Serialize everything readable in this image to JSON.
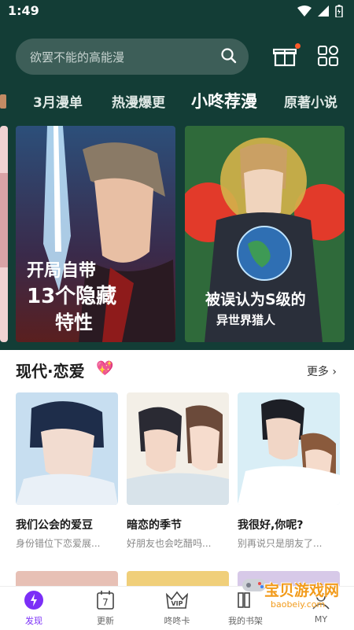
{
  "status": {
    "time": "1:49"
  },
  "search": {
    "placeholder": "欲罢不能的高能漫"
  },
  "tabs": [
    "3月漫单",
    "热漫爆更",
    "小咚荐漫",
    "原著小说"
  ],
  "active_tab_index": 2,
  "banners": [
    {
      "title_line1": "开局自带",
      "title_line2": "13个隐藏",
      "title_line3": "特性"
    },
    {
      "title_line1": "被误认为S级的",
      "title_line2": "异世界猎人"
    }
  ],
  "section": {
    "title": "现代·恋爱",
    "more": "更多"
  },
  "cards": [
    {
      "title": "我们公会的爱豆",
      "subtitle": "身份错位下恋爱展..."
    },
    {
      "title": "暗恋的季节",
      "subtitle": "好朋友也会吃醋吗..."
    },
    {
      "title": "我很好,你呢?",
      "subtitle": "别再说只是朋友了..."
    }
  ],
  "nav": [
    {
      "label": "发现",
      "icon": "discover-icon"
    },
    {
      "label": "更新",
      "icon": "calendar-icon",
      "badge": "7"
    },
    {
      "label": "咚咚卡",
      "icon": "vip-icon",
      "badge": "VIP"
    },
    {
      "label": "我的书架",
      "icon": "bookshelf-icon"
    },
    {
      "label": "MY",
      "icon": "profile-icon"
    }
  ],
  "watermark": {
    "line1": "宝贝游戏网",
    "line2": "baobeiy.com"
  },
  "colors": {
    "header_bg": "#133d36",
    "active_nav": "#7b2ff7",
    "badge": "#ff5a2a"
  }
}
